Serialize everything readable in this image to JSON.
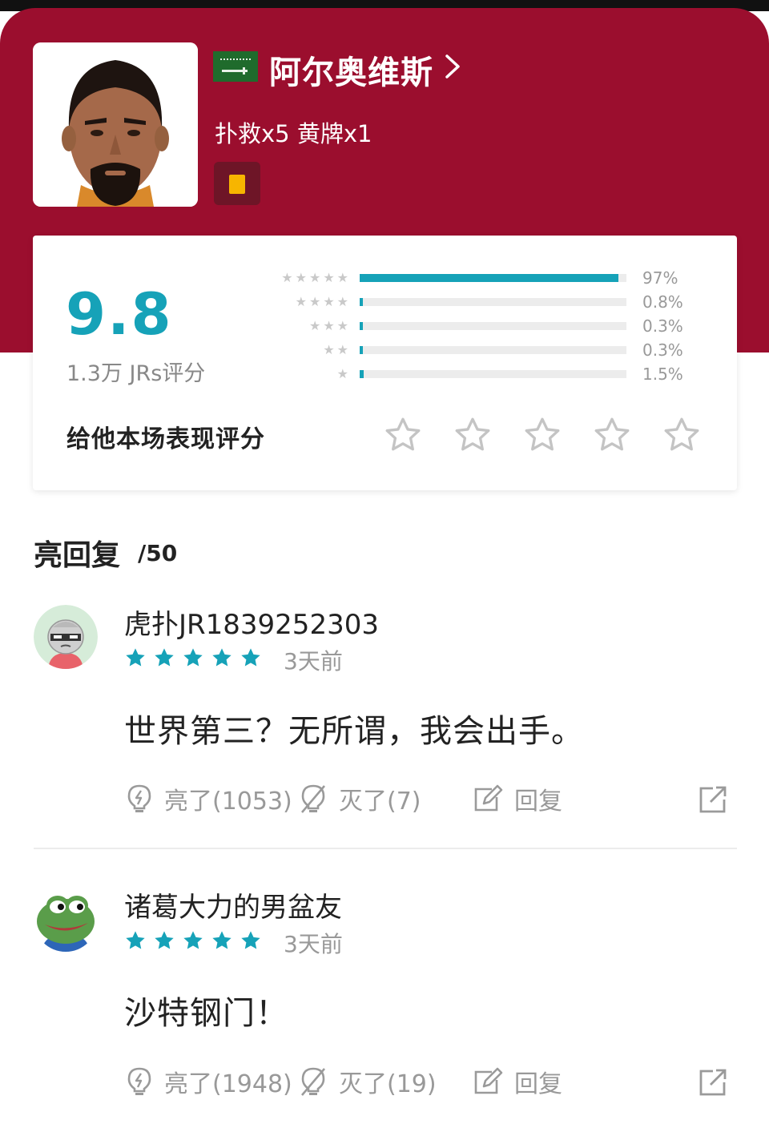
{
  "player": {
    "name": "阿尔奥维斯",
    "stats": "扑救x5 黄牌x1",
    "flag_icon": "saudi-arabia-flag",
    "card_icon": "yellow-card-icon",
    "hero_color": "#9b0e2e",
    "card_color": "#f7b500"
  },
  "rating": {
    "score": "9.8",
    "count_label": "1.3万 JRs评分",
    "accent_color": "#16a2b8",
    "distribution": [
      {
        "stars": "★★★★★",
        "pct_label": "97%",
        "pct": 97
      },
      {
        "stars": "★★★★",
        "pct_label": "0.8%",
        "pct": 0.8
      },
      {
        "stars": "★★★",
        "pct_label": "0.3%",
        "pct": 0.3
      },
      {
        "stars": "★★",
        "pct_label": "0.3%",
        "pct": 0.3
      },
      {
        "stars": "★",
        "pct_label": "1.5%",
        "pct": 1.5
      }
    ],
    "prompt": "给他本场表现评分",
    "user_rating": 0,
    "max_rating": 5
  },
  "replies": {
    "title": "亮回复",
    "count": "/50",
    "items": [
      {
        "username": "虎扑JR1839252303",
        "avatar_icon": "robot-sunglasses-avatar",
        "stars": 5,
        "time": "3天前",
        "text": "世界第三？无所谓，我会出手。",
        "like_label": "亮了(1053)",
        "dislike_label": "灭了(7)",
        "reply_label": "回复"
      },
      {
        "username": "诸葛大力的男盆友",
        "avatar_icon": "pepe-frog-avatar",
        "stars": 5,
        "time": "3天前",
        "text": "沙特钢门！",
        "like_label": "亮了(1948)",
        "dislike_label": "灭了(19)",
        "reply_label": "回复"
      }
    ]
  }
}
